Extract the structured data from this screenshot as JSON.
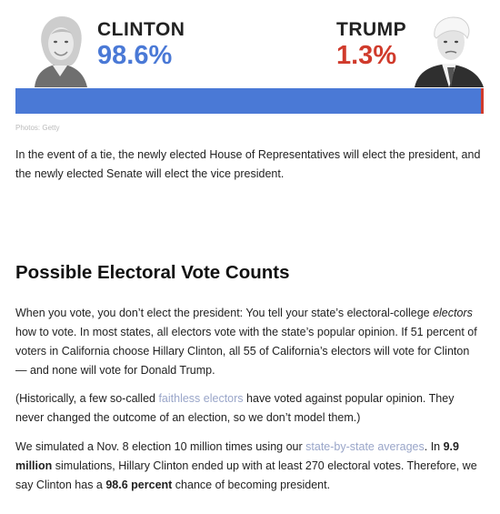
{
  "candidates": {
    "clinton": {
      "name": "CLINTON",
      "pct": "98.6%",
      "color": "#4a79d6"
    },
    "trump": {
      "name": "TRUMP",
      "pct": "1.3%",
      "color": "#d03b2c"
    }
  },
  "probability_bar": {
    "clinton_share": 0.986,
    "trump_share": 0.013
  },
  "photo_credit": "Photos: Getty",
  "tie_paragraph": "In the event of a tie, the newly elected House of Representatives will elect the president, and the newly elected Senate will elect the vice president.",
  "section_title": "Possible Electoral Vote Counts",
  "paragraph1": {
    "part1": "When you vote, you don’t elect the president: You tell your state’s electoral-college ",
    "em": "electors",
    "part2": " how to vote. In most states, all electors vote with the state’s popular opinion. If 51 percent of voters in California choose Hillary Clinton, all 55 of California’s electors will vote for Clinton — and none will vote for Donald Trump."
  },
  "paragraph2": {
    "part1": "(Historically, a few so-called ",
    "link": "faithless electors",
    "part2": " have voted against popular opinion. They never changed the outcome of an election, so we don’t model them.)"
  },
  "paragraph3": {
    "part1": "We simulated a Nov. 8 election 10 million times using our ",
    "link": "state-by-state averages",
    "part2": ". In ",
    "bold1": "9.9 million",
    "part3": " simulations, Hillary Clinton ended up with at least 270 electoral votes. Therefore, we say Clinton has a ",
    "bold2": "98.6 percent",
    "part4": " chance of becoming president."
  }
}
